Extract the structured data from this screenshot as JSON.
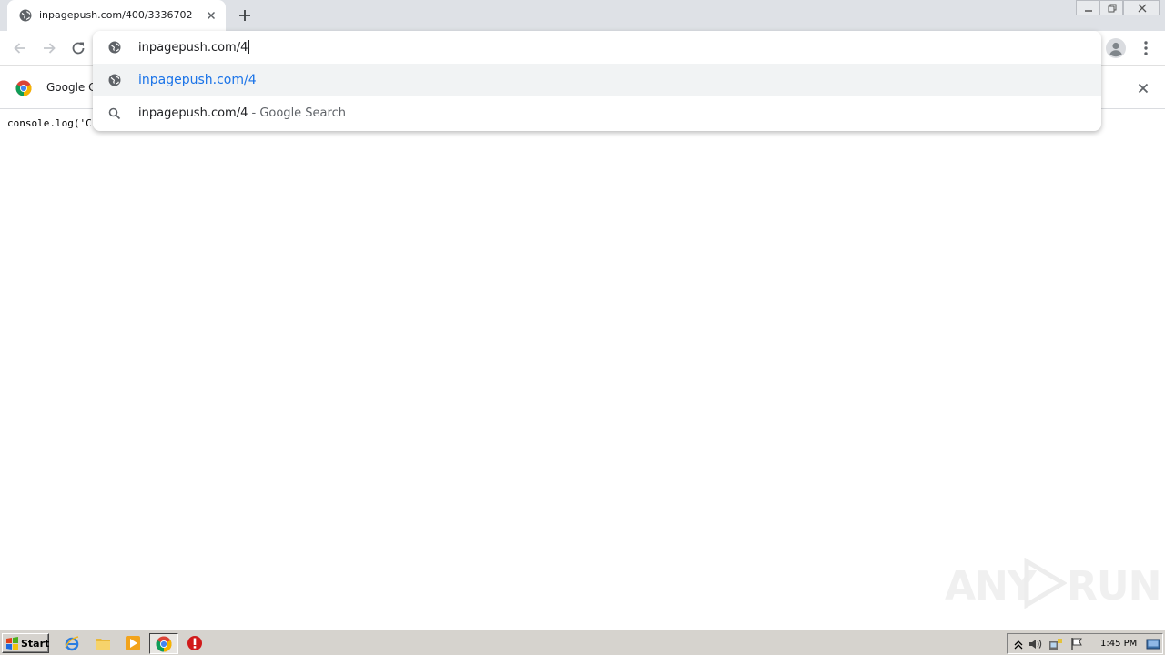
{
  "browser": {
    "tab": {
      "title": "inpagepush.com/400/3336702"
    },
    "omnibox": {
      "typed_text": "inpagepush.com/4",
      "suggestions": [
        {
          "text": "inpagepush.com/4",
          "kind": "url",
          "icon": "globe-icon"
        },
        {
          "text": "inpagepush.com/4",
          "suffix": " - Google Search",
          "kind": "search",
          "icon": "search-icon"
        }
      ]
    },
    "infobar": {
      "text": "Google Cl"
    },
    "colors": {
      "link": "#1a73e8",
      "tabstrip": "#dee1e6",
      "selected_row": "#f1f3f4"
    }
  },
  "page": {
    "code_line": "console.log('C"
  },
  "watermark": {
    "left": "ANY",
    "right": "RUN"
  },
  "taskbar": {
    "start_label": "Start",
    "clock": "1:45 PM"
  }
}
